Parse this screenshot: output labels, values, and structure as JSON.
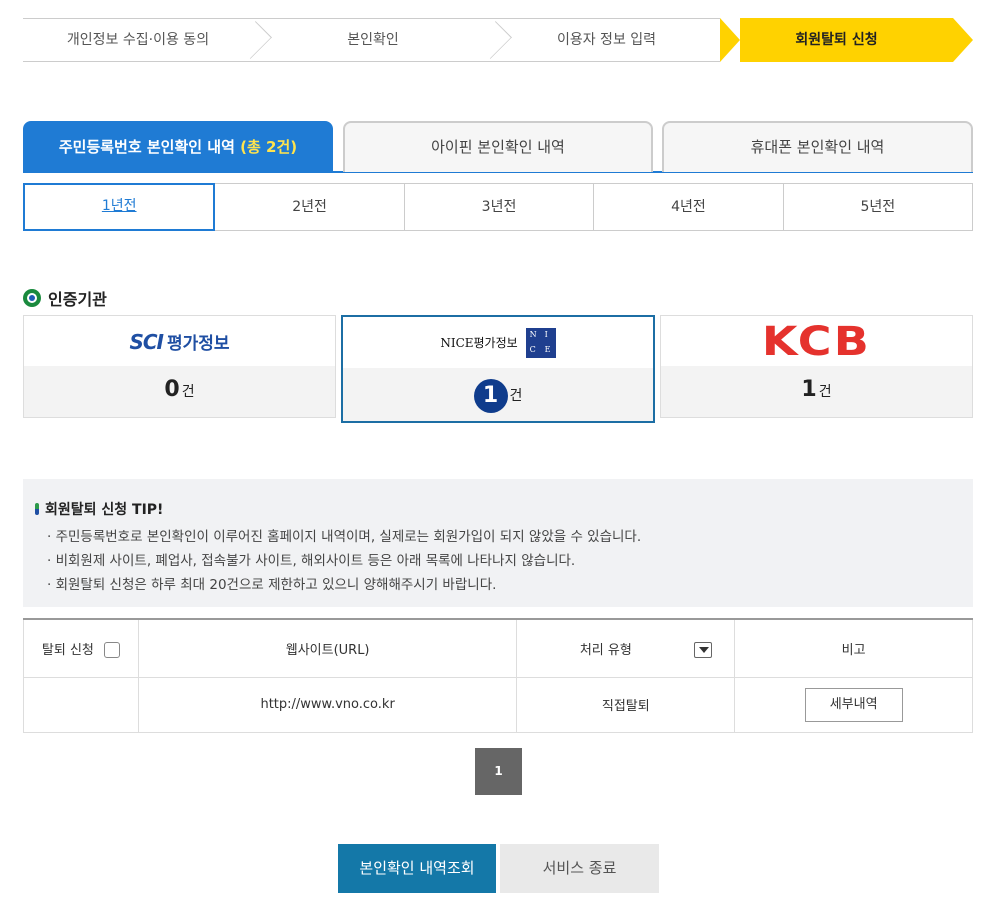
{
  "steps": [
    {
      "label": "개인정보 수집·이용 동의"
    },
    {
      "label": "본인확인"
    },
    {
      "label": "이용자 정보 입력"
    },
    {
      "label": "회원탈퇴 신청"
    }
  ],
  "main_tabs": [
    {
      "label": "주민등록번호 본인확인 내역",
      "count": "(총 2건)"
    },
    {
      "label": "아이핀 본인확인 내역"
    },
    {
      "label": "휴대폰 본인확인 내역"
    }
  ],
  "year_tabs": [
    "1년전",
    "2년전",
    "3년전",
    "4년전",
    "5년전"
  ],
  "agencies": {
    "title": "인증기관",
    "items": [
      {
        "logo_text": "SCI",
        "logo_kr": "평가정보",
        "count": "0",
        "unit": "건"
      },
      {
        "logo_text": "NICE평가정보",
        "box": [
          "N",
          "I",
          "C",
          "E"
        ],
        "count": "1",
        "unit": "건"
      },
      {
        "logo_text": "KCB",
        "count": "1",
        "unit": "건"
      }
    ]
  },
  "tip": {
    "title": "회원탈퇴 신청 TIP!",
    "lines": [
      "· 주민등록번호로 본인확인이 이루어진 홈페이지 내역이며, 실제로는 회원가입이 되지 않았을 수 있습니다.",
      "· 비회원제 사이트, 폐업사, 접속불가 사이트, 해외사이트 등은 아래 목록에 나타나지 않습니다.",
      "· 회원탈퇴 신청은 하루 최대 20건으로 제한하고 있으니 양해해주시기 바랍니다."
    ]
  },
  "table": {
    "headers": [
      "탈퇴 신청",
      "웹사이트(URL)",
      "처리 유형",
      "비고"
    ],
    "rows": [
      {
        "url": "http://www.vno.co.kr",
        "type": "직접탈퇴",
        "action": "세부내역"
      }
    ]
  },
  "pagination": {
    "current": "1"
  },
  "buttons": {
    "primary": "본인확인 내역조회",
    "secondary": "서비스 종료"
  },
  "colors": {
    "accent": "#1f7bd4",
    "step_active": "#ffd200",
    "primary_button": "#1478a8",
    "kcb_red": "#e5322d"
  }
}
